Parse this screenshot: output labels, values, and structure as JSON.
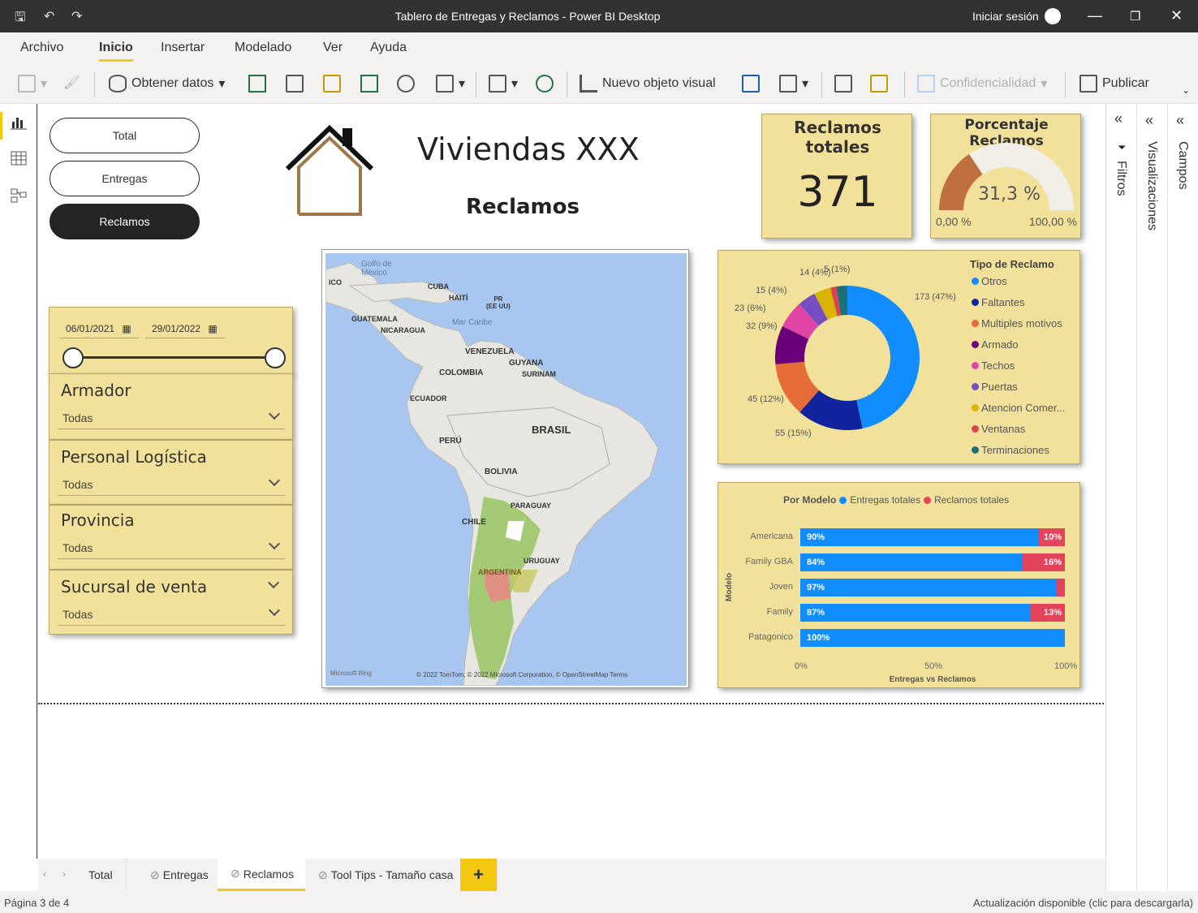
{
  "window": {
    "title": "Tablero de Entregas y Reclamos - Power BI Desktop",
    "signin": "Iniciar sesión"
  },
  "menu": [
    "Archivo",
    "Inicio",
    "Insertar",
    "Modelado",
    "Ver",
    "Ayuda"
  ],
  "ribbon": {
    "get_data": "Obtener datos",
    "new_visual": "Nuevo objeto visual",
    "sensitivity": "Confidencialidad",
    "publish": "Publicar"
  },
  "nav_buttons": [
    "Total",
    "Entregas",
    "Reclamos"
  ],
  "header": {
    "title": "Viviendas XXX",
    "subtitle": "Reclamos"
  },
  "kpi": {
    "title": "Reclamos totales",
    "value": "371"
  },
  "gauge": {
    "title": "Porcentaje Reclamos",
    "value_label": "31,3 %",
    "value": 0.313,
    "min": "0,00 %",
    "max": "100,00 %"
  },
  "date_slicer": {
    "start": "06/01/2021",
    "end": "29/01/2022"
  },
  "slicers": [
    {
      "title": "Armador",
      "value": "Todas"
    },
    {
      "title": "Personal Logística",
      "value": "Todas"
    },
    {
      "title": "Provincia",
      "value": "Todas"
    },
    {
      "title": "Sucursal de venta",
      "value": "Todas"
    }
  ],
  "map": {
    "labels": [
      "Golfo de",
      "México",
      "ICO",
      "CUBA",
      "HAITÍ",
      "PR",
      "(EE UU)",
      "GUATEMALA",
      "NICARAGUA",
      "Mar Caribe",
      "VENEZUELA",
      "GUYANA",
      "SURINAM",
      "COLOMBIA",
      "ECUADOR",
      "BRASIL",
      "PERÚ",
      "BOLIVIA",
      "PARAGUAY",
      "CHILE",
      "URUGUAY",
      "ARGENTINA"
    ],
    "attribution": "Microsoft Bing",
    "copyright": "© 2022 TomTom, © 2022 Microsoft Corporation, © OpenStreetMap Terms"
  },
  "chart_data": [
    {
      "type": "donut",
      "legend_title": "Tipo de Reclamo",
      "categories": [
        "Otros",
        "Faltantes",
        "Multiples motivos",
        "Armado",
        "Techos",
        "Puertas",
        "Atencion Comer...",
        "Ventanas",
        "Terminaciones"
      ],
      "values": [
        173,
        55,
        45,
        32,
        23,
        15,
        14,
        5,
        9
      ],
      "labels": [
        "173 (47%)",
        "55 (15%)",
        "45 (12%)",
        "32 (9%)",
        "23 (6%)",
        "15 (4%)",
        "14 (4%)",
        "5 (1%)",
        ""
      ],
      "colors": [
        "#118dff",
        "#12239e",
        "#e66c37",
        "#6b007b",
        "#e044a7",
        "#744ec2",
        "#d9b300",
        "#d64550",
        "#197278"
      ]
    },
    {
      "type": "bar",
      "stacked_100": true,
      "title": "Por Modelo",
      "series": [
        {
          "name": "Entregas totales",
          "color": "#118dff",
          "values": [
            90,
            84,
            97,
            87,
            100
          ]
        },
        {
          "name": "Reclamos totales",
          "color": "#e3435b",
          "values": [
            10,
            16,
            3,
            13,
            0
          ]
        }
      ],
      "categories": [
        "Americana",
        "Family GBA",
        "Joven",
        "Family",
        "Patagonico"
      ],
      "value_labels": {
        "blue": [
          "90%",
          "84%",
          "97%",
          "87%",
          "100%"
        ],
        "red": [
          "10%",
          "16%",
          "",
          "13%",
          ""
        ]
      },
      "xticks": [
        "0%",
        "50%",
        "100%"
      ],
      "xlabel": "Entregas vs Reclamos",
      "ylabel": "Modelo"
    }
  ],
  "panes": {
    "filters": "Filtros",
    "visualizations": "Visualizaciones",
    "fields": "Campos"
  },
  "tabs": [
    "Total",
    "Entregas",
    "Reclamos",
    "Tool Tips - Tamaño casa"
  ],
  "tab_add": "+",
  "status": {
    "page": "Página 3 de 4",
    "update": "Actualización disponible (clic para descargarla)"
  }
}
